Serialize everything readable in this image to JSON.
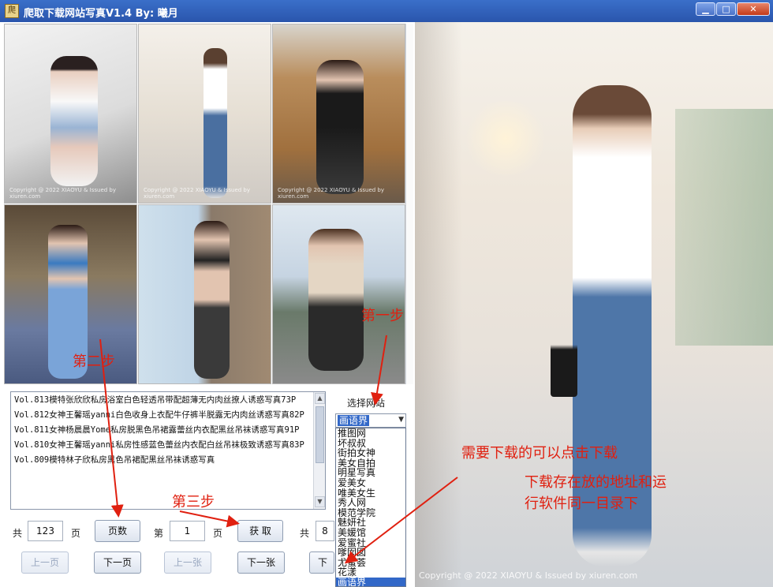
{
  "window": {
    "icon_char": "爬",
    "title": "爬取下载网站写真V1.4   By: 曦月",
    "minimize": "▁",
    "maximize": "□",
    "close": "✕"
  },
  "preview": {
    "copyright": "Copyright @ 2022 XIAOYU & Issued by xiuren.com"
  },
  "thumbnails": [
    {
      "caption": "Copyright @ 2022 XIAOYU & Issued by xiuren.com"
    },
    {
      "caption": "Copyright @ 2022 XIAOYU & Issued by xiuren.com"
    },
    {
      "caption": "Copyright @ 2022 XIAOYU & Issued by xiuren.com"
    },
    {
      "caption": ""
    },
    {
      "caption": ""
    },
    {
      "caption": ""
    }
  ],
  "description_list": [
    "Vol.813模特张欣欣私房浴室白色轻透吊带配超薄无内肉丝撩人诱惑写真73P",
    "Vol.812女神王馨瑶yanni白色收身上衣配牛仔裤半脱露无内肉丝诱惑写真82P",
    "Vol.811女神杨晨晨Yome私房脱黑色吊裙露蕾丝内衣配黑丝吊袜诱惑写真91P",
    "Vol.810女神王馨瑶yanni私房性感蓝色蕾丝内衣配白丝吊袜极致诱惑写真83P",
    "Vol.809模特林子欣私房黑色吊裙配黑丝吊袜诱惑写真"
  ],
  "site_selector": {
    "label": "选择网站",
    "selected": "画语界",
    "options": [
      "推图网",
      "坏叔叔",
      "街拍女神",
      "美女自拍",
      "明星写真",
      "爱美女",
      "唯美女生",
      "秀人网",
      "模范学院",
      "魅妍社",
      "美媛馆",
      "爱蜜社",
      "嗲囡囡",
      "尤蜜荟",
      "花漾",
      "画语界"
    ]
  },
  "controls": {
    "total_label": "共",
    "total_pages": "123",
    "page_unit": "页",
    "page_count_btn": "页数",
    "nth_label": "第",
    "current_page": "1",
    "fetch_btn": "获 取",
    "total2_label": "共",
    "total2_value": "8",
    "prev_page": "上一页",
    "next_page": "下一页",
    "prev_image": "上一张",
    "next_image": "下一张",
    "download": "下载"
  },
  "annotations": {
    "step1": "第一步",
    "step2": "第二步",
    "step3": "第三步",
    "hint1": "需要下载的可以点击下载",
    "hint2_line1": "下载存在放的地址和运",
    "hint2_line2": "行软件同一目录下"
  },
  "colors": {
    "titlebar": "#2a55ac",
    "annotation_red": "#e02010",
    "selection_blue": "#3268c8"
  }
}
